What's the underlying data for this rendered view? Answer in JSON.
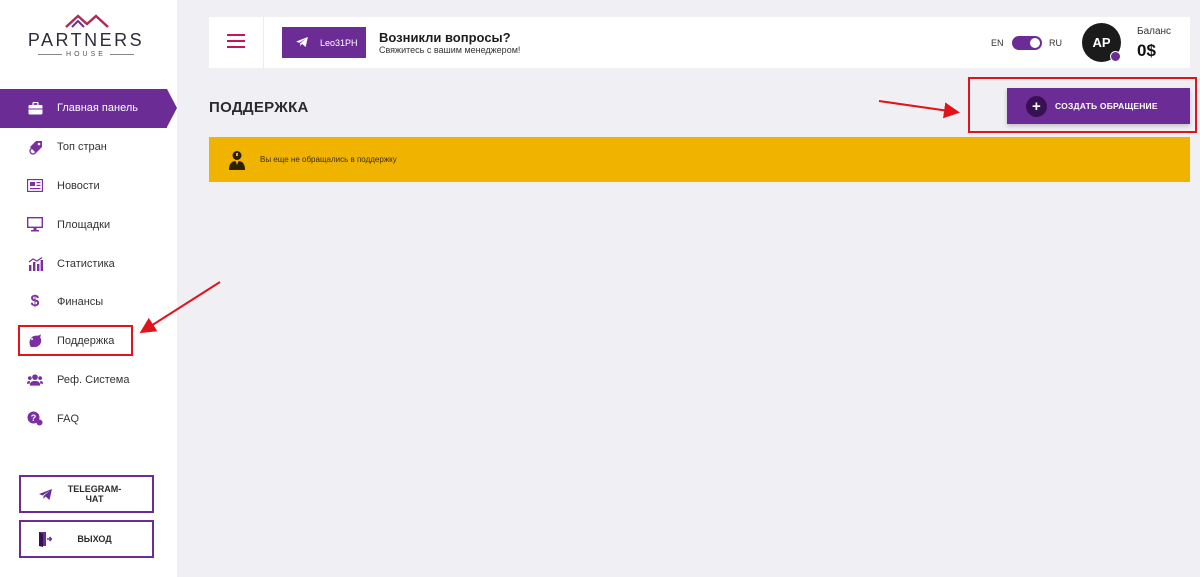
{
  "brand": {
    "name": "PARTNERS",
    "sub": "HOUSE"
  },
  "sidebar": {
    "items": [
      {
        "label": "Главная панель",
        "icon": "briefcase-icon",
        "active": true
      },
      {
        "label": "Топ стран",
        "icon": "globe-tag-icon",
        "active": false
      },
      {
        "label": "Новости",
        "icon": "newspaper-icon",
        "active": false
      },
      {
        "label": "Площадки",
        "icon": "monitor-icon",
        "active": false
      },
      {
        "label": "Статистика",
        "icon": "chart-icon",
        "active": false
      },
      {
        "label": "Финансы",
        "icon": "dollar-icon",
        "active": false
      },
      {
        "label": "Поддержка",
        "icon": "support-icon",
        "active": false
      },
      {
        "label": "Реф. Система",
        "icon": "users-icon",
        "active": false
      },
      {
        "label": "FAQ",
        "icon": "question-icon",
        "active": false
      }
    ],
    "telegram_chat": "TELEGRAM-ЧАТ",
    "logout": "ВЫХОД"
  },
  "header": {
    "manager_handle": "Leo31PH",
    "question_title": "Возникли вопросы?",
    "question_sub": "Свяжитесь с вашим менеджером!",
    "lang_en": "EN",
    "lang_ru": "RU",
    "avatar_initials": "AP",
    "balance_label": "Баланс",
    "balance_value": "0$"
  },
  "page": {
    "title": "ПОДДЕРЖКА",
    "create_button": "СОЗДАТЬ ОБРАЩЕНИЕ",
    "alert_text": "Вы еще не обращались в поддержку"
  },
  "colors": {
    "accent": "#6c2c96",
    "alert": "#f0b400",
    "annotation": "#e0141b",
    "background": "#f0eff4"
  }
}
